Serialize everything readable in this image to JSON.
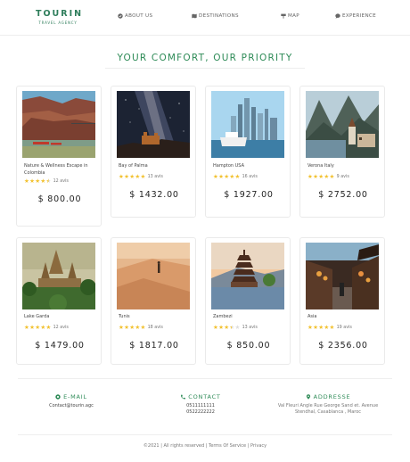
{
  "brand": {
    "name": "TOURIN",
    "tagline": "TRAVEL AGENCY",
    "accent": "#2e8b57"
  },
  "nav": [
    {
      "label": "ABOUT US",
      "icon": "check-circle-icon"
    },
    {
      "label": "DESTINATIONS",
      "icon": "map-icon"
    },
    {
      "label": "MAP",
      "icon": "signpost-icon"
    },
    {
      "label": "EXPERIENCE",
      "icon": "chat-icon"
    }
  ],
  "section_title": "YOUR COMFORT, OUR PRIORITY",
  "destinations": [
    {
      "name": "Nature & Wellness Escape in Colombia",
      "stars": 4.5,
      "reviews": "12 avis",
      "price": "$ 800.00",
      "photo": "canyon-river"
    },
    {
      "name": "Bay of Palma",
      "stars": 5,
      "reviews": "13 avis",
      "price": "$ 1432.00",
      "photo": "milky-way-castle"
    },
    {
      "name": "Hampton USA",
      "stars": 5,
      "reviews": "16 avis",
      "price": "$ 1927.00",
      "photo": "city-harbor"
    },
    {
      "name": "Verona Italy",
      "stars": 5,
      "reviews": "9 avis",
      "price": "$ 2752.00",
      "photo": "mountain-lake-village"
    },
    {
      "name": "Lake Garda",
      "stars": 5,
      "reviews": "12 avis",
      "price": "$ 1479.00",
      "photo": "temple-jungle"
    },
    {
      "name": "Tunis",
      "stars": 5,
      "reviews": "18 avis",
      "price": "$ 1817.00",
      "photo": "desert-walker"
    },
    {
      "name": "Zambezi",
      "stars": 3.5,
      "reviews": "13 avis",
      "price": "$ 850.00",
      "photo": "pagoda-lake"
    },
    {
      "name": "Asia",
      "stars": 5,
      "reviews": "19 avis",
      "price": "$ 2356.00",
      "photo": "lantern-street"
    }
  ],
  "footer": {
    "email": {
      "title": "E-MAIL",
      "value": "Contact@tourin.agc"
    },
    "contact": {
      "title": "CONTACT",
      "lines": [
        "0511111111",
        "0522222222"
      ]
    },
    "address": {
      "title": "ADDRESSE",
      "lines": [
        "Val Fleuri Angle Rue George Sand et. Avenue",
        "Stendhal, Casablanca , Maroc"
      ]
    },
    "copyright": "©2021 | All rights reserved |",
    "links": [
      "Terms Of Service",
      "Privacy"
    ]
  }
}
